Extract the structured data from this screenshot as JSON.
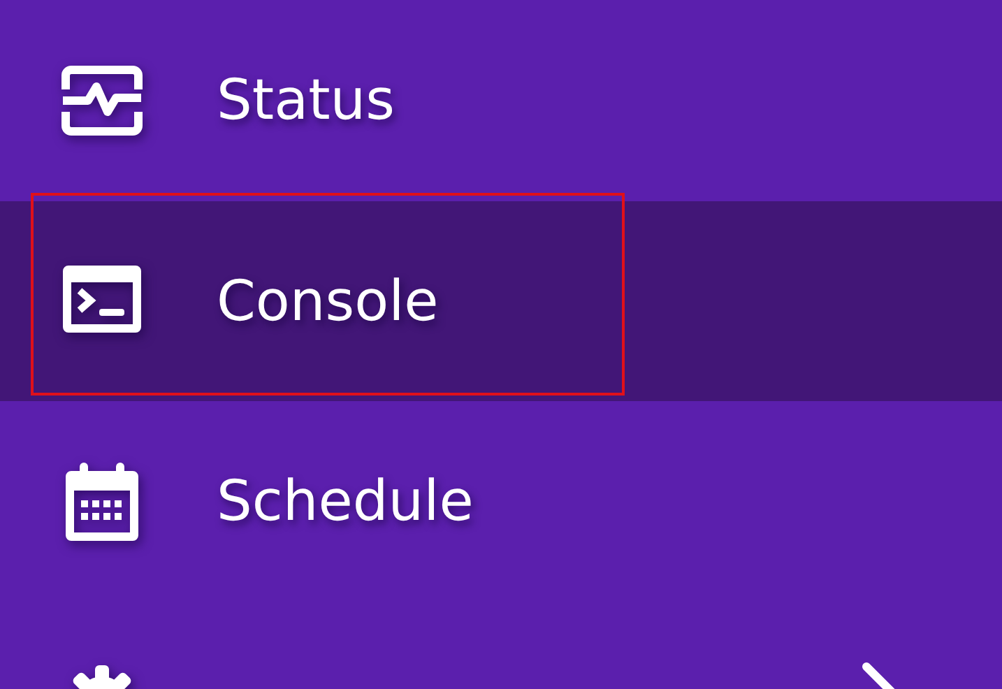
{
  "menu": {
    "items": [
      {
        "label": "Status",
        "kind": "status",
        "selected": false,
        "outlined": false,
        "has_submenu": false
      },
      {
        "label": "Console",
        "kind": "console",
        "selected": true,
        "outlined": true,
        "has_submenu": false
      },
      {
        "label": "Schedule",
        "kind": "schedule",
        "selected": false,
        "outlined": false,
        "has_submenu": false
      },
      {
        "kind": "settings",
        "selected": false,
        "outlined": false,
        "has_submenu": true
      }
    ]
  }
}
